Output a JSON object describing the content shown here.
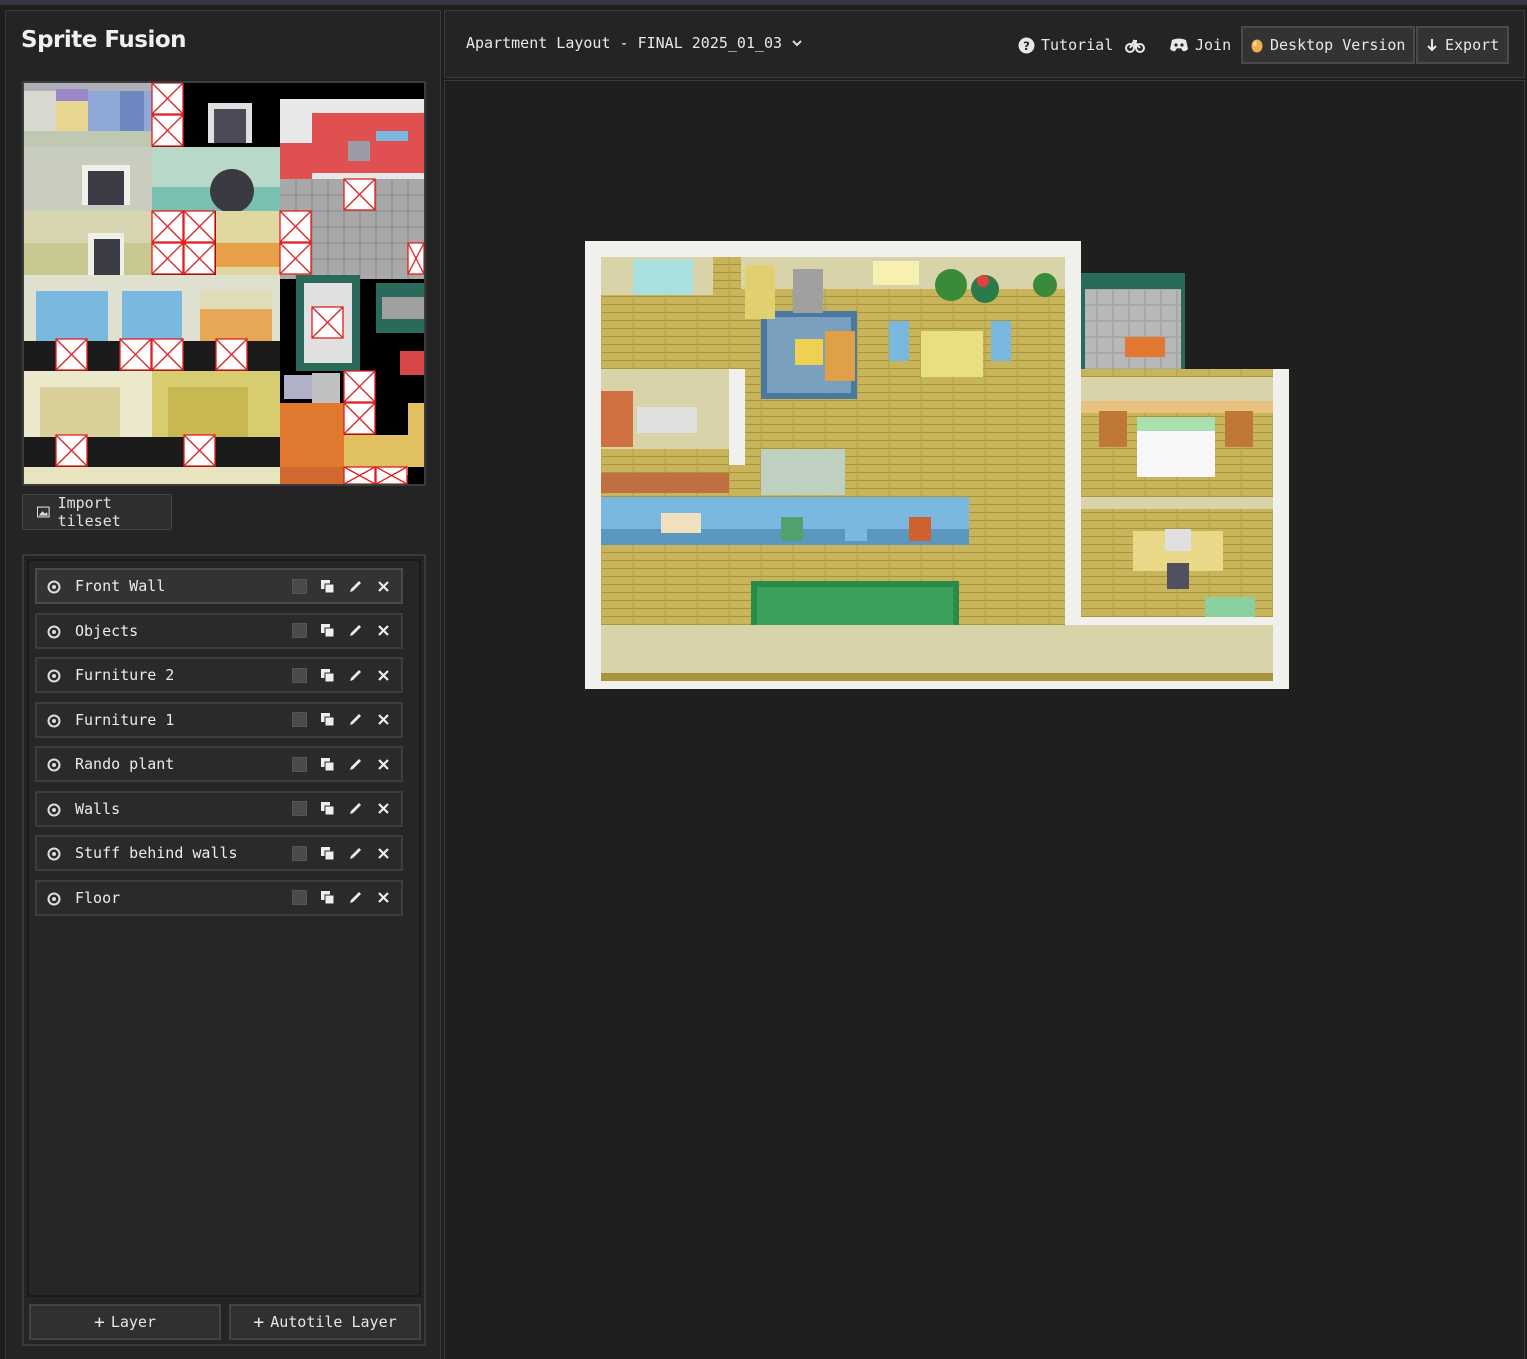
{
  "app": {
    "title": "Sprite Fusion"
  },
  "tileset": {
    "import_label": "Import tileset"
  },
  "layers": {
    "items": [
      {
        "name": "Front Wall",
        "selected": true
      },
      {
        "name": "Objects"
      },
      {
        "name": "Furniture 2"
      },
      {
        "name": "Furniture 1"
      },
      {
        "name": "Rando plant"
      },
      {
        "name": "Walls"
      },
      {
        "name": "Stuff behind walls"
      },
      {
        "name": "Floor"
      }
    ],
    "add_layer_label": "Layer",
    "add_autotile_label": "Autotile Layer"
  },
  "topbar": {
    "project_name": "Apartment Layout - FINAL 2025_01_03",
    "tutorial_label": "Tutorial",
    "join_label": "Join",
    "desktop_label": "Desktop Version",
    "export_label": "Export"
  },
  "icons": {
    "eye": "eye-icon",
    "checkbox": "lock-checkbox-icon",
    "duplicate": "duplicate-icon",
    "edit": "pencil-icon",
    "delete": "close-icon",
    "plus": "plus-icon",
    "image": "image-icon",
    "help": "help-icon",
    "bike": "bicycle-icon",
    "discord": "discord-icon",
    "egg": "egg-icon",
    "download": "download-arrow-icon",
    "chevron": "chevron-down-icon"
  },
  "colors": {
    "bg": "#1e1e1e",
    "panel": "#242424",
    "floor": "#c8b45a",
    "wall": "#d8d3a8",
    "accent_blue": "#7ab8e0",
    "rug_green": "#3aa05a"
  }
}
